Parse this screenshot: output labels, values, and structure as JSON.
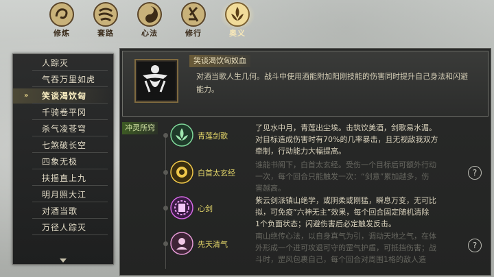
{
  "tabs": [
    {
      "label": "修炼",
      "icon": "swirl-icon"
    },
    {
      "label": "套路",
      "icon": "wind-emblem-icon"
    },
    {
      "label": "心法",
      "icon": "yin-yang-swirl-icon"
    },
    {
      "label": "修行",
      "icon": "calligraphy-icon"
    },
    {
      "label": "奥义",
      "icon": "lotus-flame-icon",
      "active": true
    }
  ],
  "skill_list": {
    "items": [
      "人踪灭",
      "气吞万里如虎",
      "笑谈渴饮匈",
      "千骑卷平冈",
      "杀气凌苍穹",
      "七煞破长空",
      "四象无极",
      "扶摇直上九",
      "明月照大江",
      "对酒当歌",
      "万径人踪灭"
    ],
    "selected_index": 2
  },
  "detail": {
    "title": "笑谈渴饮匈奴血",
    "description": "对酒当歌人生几何。战斗中使用酒能附加阳刚技能的伤害同时提升自己身法和闪避能力。"
  },
  "section_label": "冲灵所窍",
  "rows": [
    {
      "name": "青莲剑歌",
      "name_color": "#e6d86a",
      "icon_color": "#5fbf7a",
      "lines": [
        "了见水中月，青莲出尘埃。击筑饮美酒，剑歌易水湄。",
        "对目标造成伤害时有70%的几率暴击，且无视敌我双方",
        "牵制，行动能力大幅提高。"
      ],
      "dim": false,
      "help": false
    },
    {
      "name": "白首太玄经",
      "name_color": "#e6d86a",
      "icon_color": "#e2b93a",
      "lines": [
        "谁能书阁下，白首太玄经。受伤一个目标后可额外行动",
        "一次，每个回合只能触发一次：“剑意”累加越多，伤",
        "害越高。"
      ],
      "dim": true,
      "help": true
    },
    {
      "name": "心剑",
      "name_color": "#e6d86a",
      "icon_color": "#c45ad6",
      "lines": [
        "紫云剑派镇山绝学，或阴柔或刚猛，瞬息万变，无可比",
        "拟，可免疫“六神无主”效果，每个回合固定随机清除",
        "1个负面状态；闪避伤害后必定触发反击。"
      ],
      "dim": false,
      "help": false
    },
    {
      "name": "先天清气",
      "name_color": "#e6d86a",
      "icon_color": "#d987c8",
      "lines": [
        "南山绝传心法，以自身真气为引，调动天地之气，在体",
        "外形成一个进可攻退可守的罡气护盾，可抵挡伤害；战",
        "斗时，罡风包裹自己，每个回合对周围1格的敌人造"
      ],
      "dim": true,
      "help": true
    }
  ],
  "help_label": "?"
}
